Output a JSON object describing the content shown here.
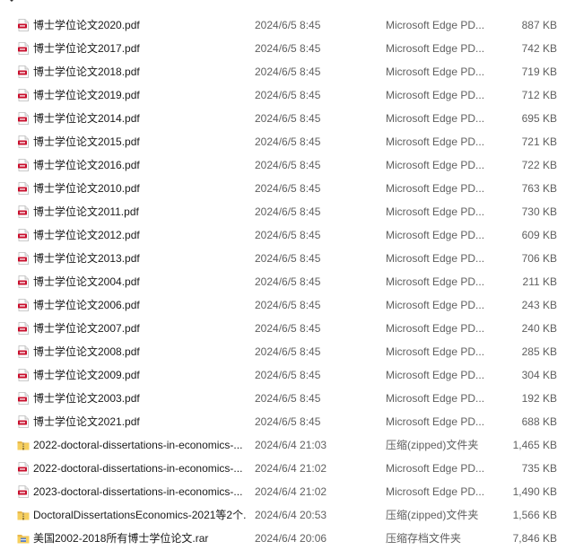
{
  "group": {
    "title": ""
  },
  "colors": {
    "pdf_icon": "#c8102e",
    "folder_icon": "#f0c14b",
    "meta_text": "#5f5f5f"
  },
  "files": [
    {
      "name": "博士学位论文2020.pdf",
      "date": "2024/6/5 8:45",
      "type": "Microsoft Edge PD...",
      "size": "887 KB",
      "icon": "pdf-icon"
    },
    {
      "name": "博士学位论文2017.pdf",
      "date": "2024/6/5 8:45",
      "type": "Microsoft Edge PD...",
      "size": "742 KB",
      "icon": "pdf-icon"
    },
    {
      "name": "博士学位论文2018.pdf",
      "date": "2024/6/5 8:45",
      "type": "Microsoft Edge PD...",
      "size": "719 KB",
      "icon": "pdf-icon"
    },
    {
      "name": "博士学位论文2019.pdf",
      "date": "2024/6/5 8:45",
      "type": "Microsoft Edge PD...",
      "size": "712 KB",
      "icon": "pdf-icon"
    },
    {
      "name": "博士学位论文2014.pdf",
      "date": "2024/6/5 8:45",
      "type": "Microsoft Edge PD...",
      "size": "695 KB",
      "icon": "pdf-icon"
    },
    {
      "name": "博士学位论文2015.pdf",
      "date": "2024/6/5 8:45",
      "type": "Microsoft Edge PD...",
      "size": "721 KB",
      "icon": "pdf-icon"
    },
    {
      "name": "博士学位论文2016.pdf",
      "date": "2024/6/5 8:45",
      "type": "Microsoft Edge PD...",
      "size": "722 KB",
      "icon": "pdf-icon"
    },
    {
      "name": "博士学位论文2010.pdf",
      "date": "2024/6/5 8:45",
      "type": "Microsoft Edge PD...",
      "size": "763 KB",
      "icon": "pdf-icon"
    },
    {
      "name": "博士学位论文2011.pdf",
      "date": "2024/6/5 8:45",
      "type": "Microsoft Edge PD...",
      "size": "730 KB",
      "icon": "pdf-icon"
    },
    {
      "name": "博士学位论文2012.pdf",
      "date": "2024/6/5 8:45",
      "type": "Microsoft Edge PD...",
      "size": "609 KB",
      "icon": "pdf-icon"
    },
    {
      "name": "博士学位论文2013.pdf",
      "date": "2024/6/5 8:45",
      "type": "Microsoft Edge PD...",
      "size": "706 KB",
      "icon": "pdf-icon"
    },
    {
      "name": "博士学位论文2004.pdf",
      "date": "2024/6/5 8:45",
      "type": "Microsoft Edge PD...",
      "size": "211 KB",
      "icon": "pdf-icon"
    },
    {
      "name": "博士学位论文2006.pdf",
      "date": "2024/6/5 8:45",
      "type": "Microsoft Edge PD...",
      "size": "243 KB",
      "icon": "pdf-icon"
    },
    {
      "name": "博士学位论文2007.pdf",
      "date": "2024/6/5 8:45",
      "type": "Microsoft Edge PD...",
      "size": "240 KB",
      "icon": "pdf-icon"
    },
    {
      "name": "博士学位论文2008.pdf",
      "date": "2024/6/5 8:45",
      "type": "Microsoft Edge PD...",
      "size": "285 KB",
      "icon": "pdf-icon"
    },
    {
      "name": "博士学位论文2009.pdf",
      "date": "2024/6/5 8:45",
      "type": "Microsoft Edge PD...",
      "size": "304 KB",
      "icon": "pdf-icon"
    },
    {
      "name": "博士学位论文2003.pdf",
      "date": "2024/6/5 8:45",
      "type": "Microsoft Edge PD...",
      "size": "192 KB",
      "icon": "pdf-icon"
    },
    {
      "name": "博士学位论文2021.pdf",
      "date": "2024/6/5 8:45",
      "type": "Microsoft Edge PD...",
      "size": "688 KB",
      "icon": "pdf-icon"
    },
    {
      "name": "2022-doctoral-dissertations-in-economics-...",
      "date": "2024/6/4 21:03",
      "type": "压缩(zipped)文件夹",
      "size": "1,465 KB",
      "icon": "zip-folder-icon"
    },
    {
      "name": "2022-doctoral-dissertations-in-economics-...",
      "date": "2024/6/4 21:02",
      "type": "Microsoft Edge PD...",
      "size": "735 KB",
      "icon": "pdf-icon"
    },
    {
      "name": "2023-doctoral-dissertations-in-economics-...",
      "date": "2024/6/4 21:02",
      "type": "Microsoft Edge PD...",
      "size": "1,490 KB",
      "icon": "pdf-icon"
    },
    {
      "name": "DoctoralDissertationsEconomics-2021等2个...",
      "date": "2024/6/4 20:53",
      "type": "压缩(zipped)文件夹",
      "size": "1,566 KB",
      "icon": "zip-folder-icon"
    },
    {
      "name": "美国2002-2018所有博士学位论文.rar",
      "date": "2024/6/4 20:06",
      "type": "压缩存档文件夹",
      "size": "7,846 KB",
      "icon": "archive-icon"
    }
  ]
}
